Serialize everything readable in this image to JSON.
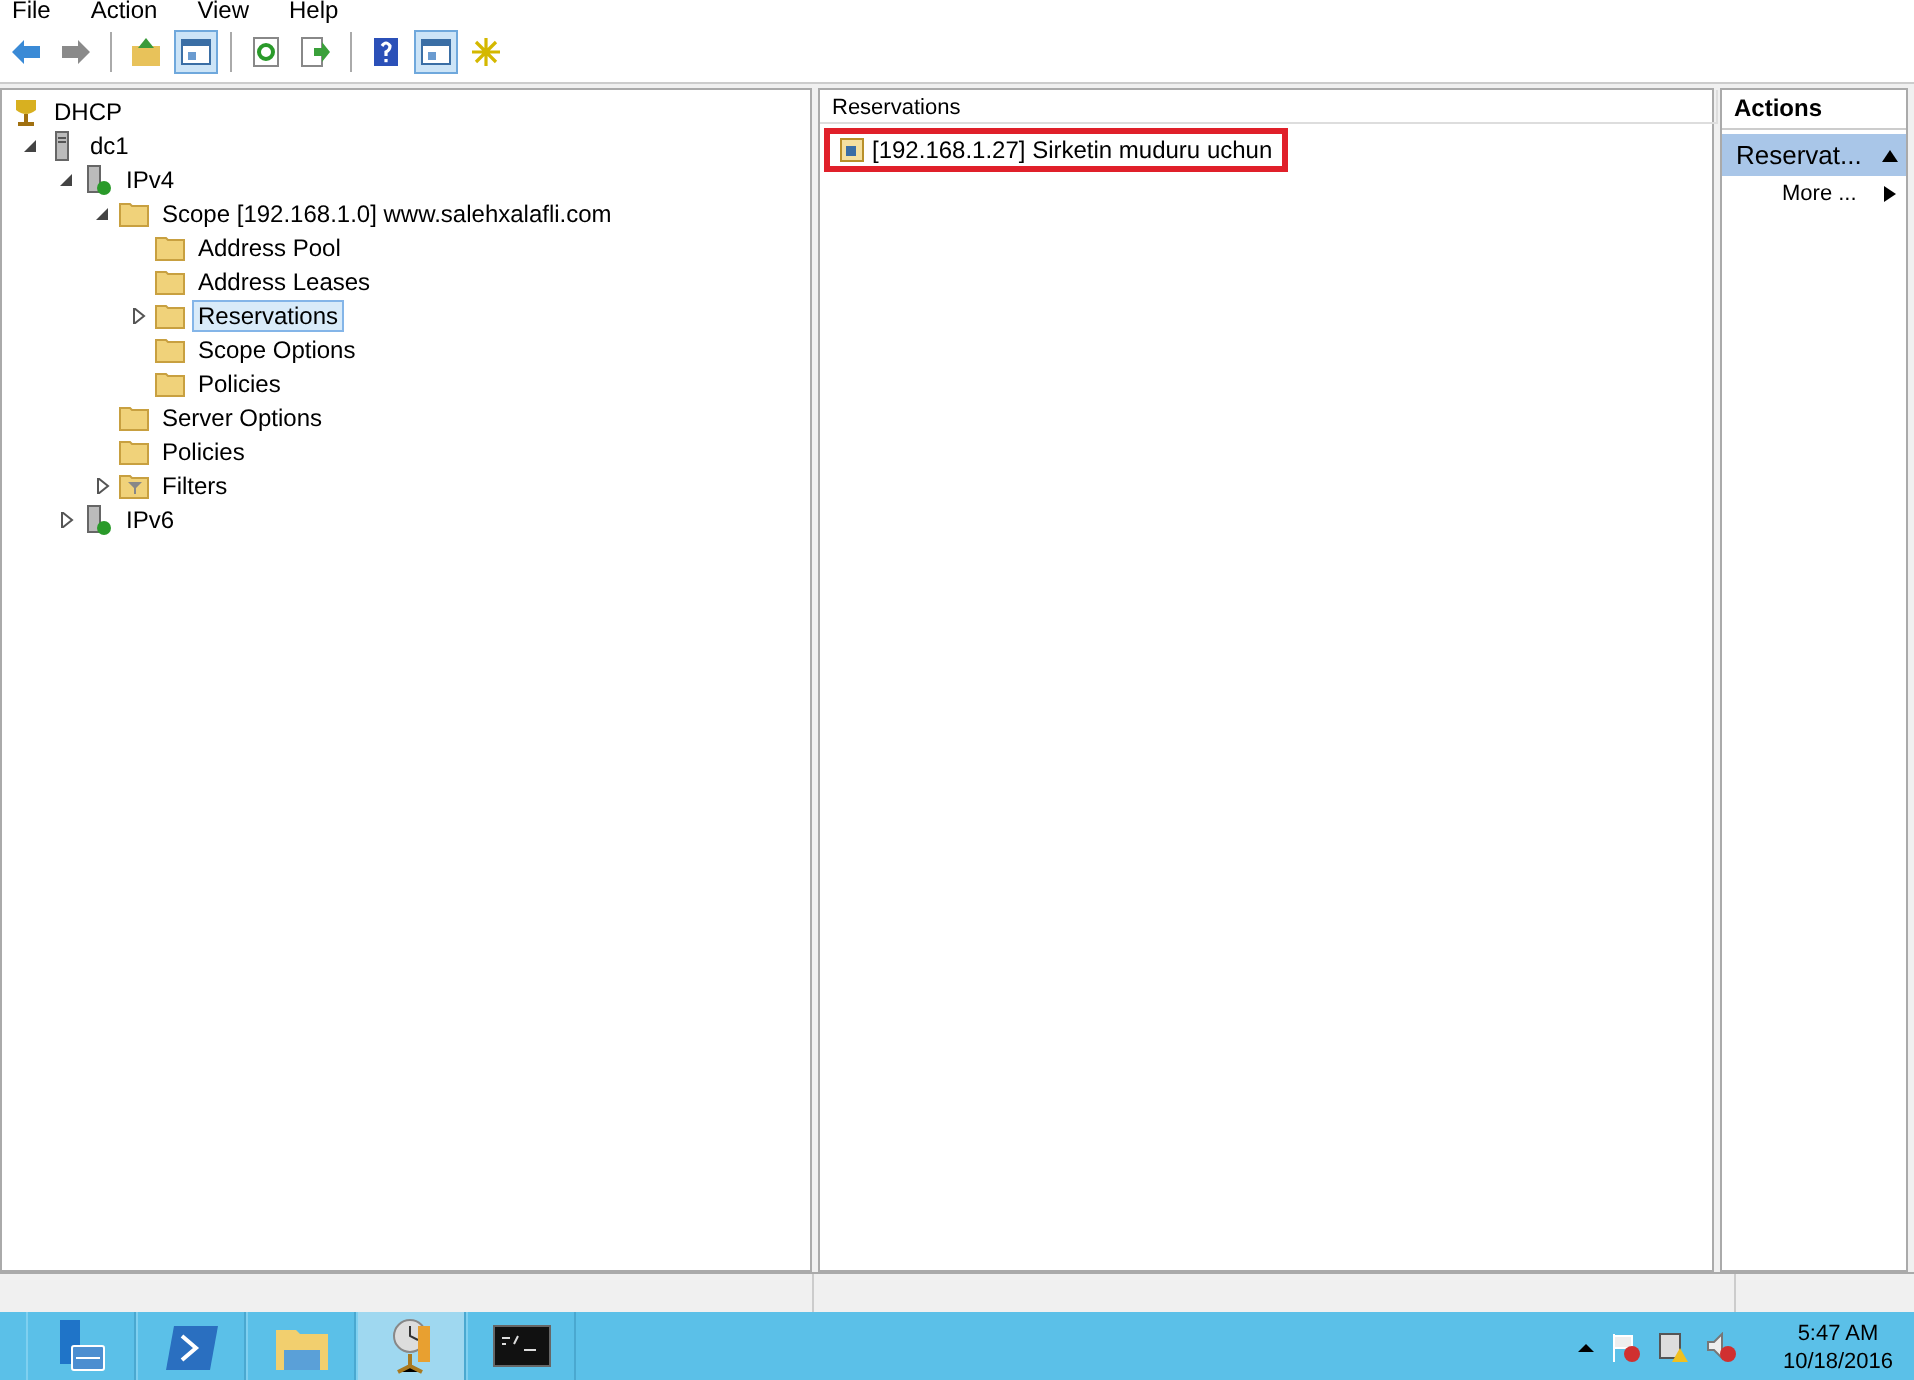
{
  "menu": [
    "File",
    "Action",
    "View",
    "Help"
  ],
  "toolbar": [
    {
      "kind": "back",
      "pressed": false
    },
    {
      "kind": "forward",
      "pressed": false
    },
    {
      "kind": "sep"
    },
    {
      "kind": "up",
      "pressed": false
    },
    {
      "kind": "pane",
      "pressed": true
    },
    {
      "kind": "sep"
    },
    {
      "kind": "refresh",
      "pressed": false
    },
    {
      "kind": "export",
      "pressed": false
    },
    {
      "kind": "sep"
    },
    {
      "kind": "help",
      "pressed": false
    },
    {
      "kind": "pane",
      "pressed": true
    },
    {
      "kind": "star",
      "pressed": false
    }
  ],
  "tree": [
    {
      "label": "DHCP",
      "kind": "dhcp",
      "selected": false,
      "children": [
        {
          "label": "dc1",
          "kind": "server",
          "expanded": true,
          "selected": false,
          "children": [
            {
              "label": "IPv4",
              "kind": "ip",
              "expanded": true,
              "selected": false,
              "children": [
                {
                  "label": "Scope [192.168.1.0] www.salehxalafli.com",
                  "kind": "folder",
                  "expanded": true,
                  "selected": false,
                  "children": [
                    {
                      "label": "Address Pool",
                      "kind": "folder",
                      "selected": false
                    },
                    {
                      "label": "Address Leases",
                      "kind": "folder",
                      "selected": false
                    },
                    {
                      "label": "Reservations",
                      "kind": "folder",
                      "expanded": false,
                      "selected": true
                    },
                    {
                      "label": "Scope Options",
                      "kind": "folder",
                      "selected": false
                    },
                    {
                      "label": "Policies",
                      "kind": "folder",
                      "selected": false
                    }
                  ]
                },
                {
                  "label": "Server Options",
                  "kind": "folder",
                  "selected": false
                },
                {
                  "label": "Policies",
                  "kind": "folder",
                  "selected": false
                },
                {
                  "label": "Filters",
                  "kind": "filter",
                  "expanded": false,
                  "selected": false
                }
              ]
            },
            {
              "label": "IPv6",
              "kind": "ip",
              "expanded": false,
              "selected": false
            }
          ]
        }
      ]
    }
  ],
  "list": {
    "column": "Reservations",
    "rows": [
      {
        "label": "[192.168.1.27] Sirketin muduru uchun",
        "highlighted": true
      }
    ]
  },
  "actions": {
    "title": "Actions",
    "section": "Reservat...",
    "items": [
      "More ..."
    ]
  },
  "taskbar": {
    "apps": [
      {
        "kind": "server-manager",
        "selected": false
      },
      {
        "kind": "powershell",
        "selected": false
      },
      {
        "kind": "explorer",
        "selected": false
      },
      {
        "kind": "dhcp",
        "selected": true
      },
      {
        "kind": "cmd",
        "selected": false
      }
    ],
    "time": "5:47 AM",
    "date": "10/18/2016"
  }
}
